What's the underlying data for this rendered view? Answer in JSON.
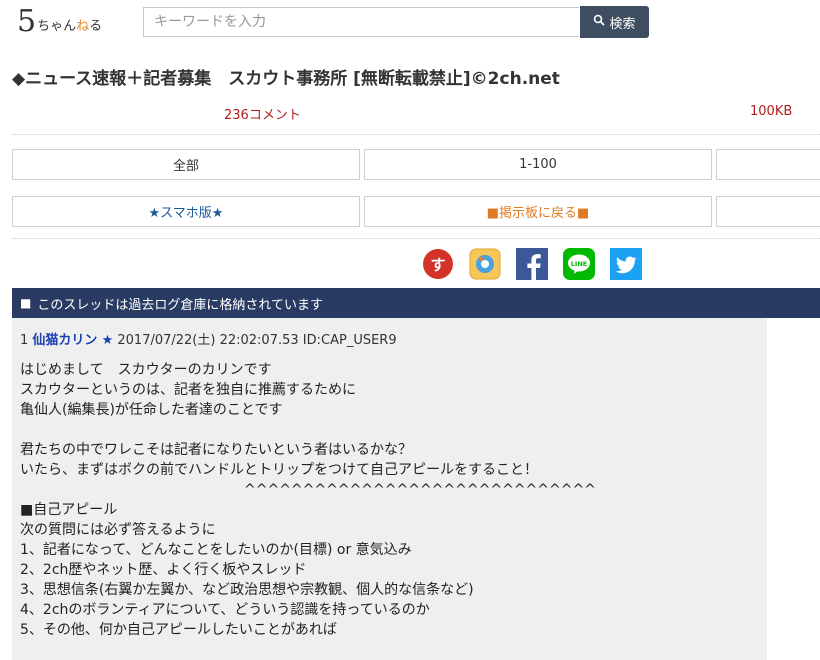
{
  "header": {
    "logo": {
      "digit": "5",
      "text_before": "ちゃん",
      "text_accent": "ね",
      "text_after": "る"
    },
    "search": {
      "placeholder": "キーワードを入力",
      "button_label": "検索"
    }
  },
  "thread": {
    "title": "◆ニュース速報＋記者募集　スカウト事務所 [無断転載禁止]©2ch.net",
    "comment_count": "236コメント",
    "size": "100KB"
  },
  "nav": {
    "row1": [
      "全部",
      "1-100",
      ""
    ],
    "row2": [
      "★スマホ版★",
      "■掲示板に戻る■",
      ""
    ]
  },
  "share": [
    {
      "icon": "matome-icon",
      "color": "#d4332a"
    },
    {
      "icon": "app-icon",
      "color": "#f2b43a"
    },
    {
      "icon": "facebook-icon",
      "color": "#3b5998"
    },
    {
      "icon": "line-icon",
      "color": "#00b900"
    },
    {
      "icon": "twitter-icon",
      "color": "#1da1f2"
    }
  ],
  "notice": {
    "bullet": "■",
    "text": "このスレッドは過去ログ倉庫に格納されています"
  },
  "post": {
    "number": "1",
    "name": "仙猫カリン",
    "star": "★",
    "datetime": "2017/07/22(土) 22:02:07.53",
    "id": "ID:CAP_USER9",
    "body": "はじめまして　スカウターのカリンです\nスカウターというのは、記者を独自に推薦するために\n亀仙人(編集長)が任命した者達のことです\n\n君たちの中でワレこそは記者になりたいという者はいるかな？\nいたら、まずはボクの前でハンドルとトリップをつけて自己アピールをすること！\n　　　　　　　　　　　　　　　　^^^^^^^^^^^^^^^^^^^^^^^^^^^^^^\n■自己アピール\n次の質問には必ず答えるように\n1、記者になって、どんなことをしたいのか(目標) or 意気込み\n2、2ch歴やネット歴、よく行く板やスレッド\n3、思想信条(右翼か左翼か、など政治思想や宗教観、個人的な信条など)\n4、2chのボランティアについて、どういう認識を持っているのか\n5、その他、何か自己アピールしたいことがあれば"
  }
}
